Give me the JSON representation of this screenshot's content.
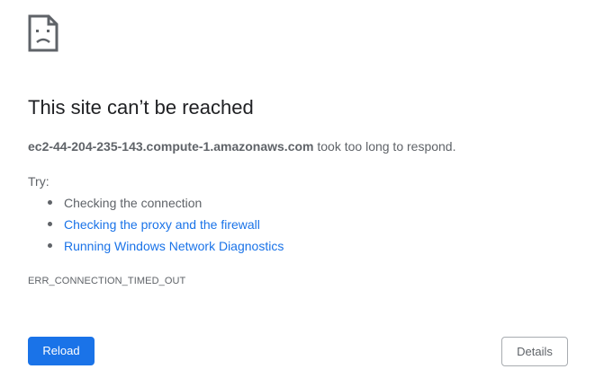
{
  "icon": "sad-page-icon",
  "title": "This site can’t be reached",
  "summary": {
    "host": "ec2-44-204-235-143.compute-1.amazonaws.com",
    "message": " took too long to respond."
  },
  "try_label": "Try:",
  "suggestions": [
    {
      "label": "Checking the connection",
      "is_link": false
    },
    {
      "label": "Checking the proxy and the firewall",
      "is_link": true
    },
    {
      "label": "Running Windows Network Diagnostics",
      "is_link": true
    }
  ],
  "error_code": "ERR_CONNECTION_TIMED_OUT",
  "buttons": {
    "reload": "Reload",
    "details": "Details"
  },
  "colors": {
    "accent": "#1a73e8",
    "text": "#5f6368",
    "title": "#202124"
  }
}
